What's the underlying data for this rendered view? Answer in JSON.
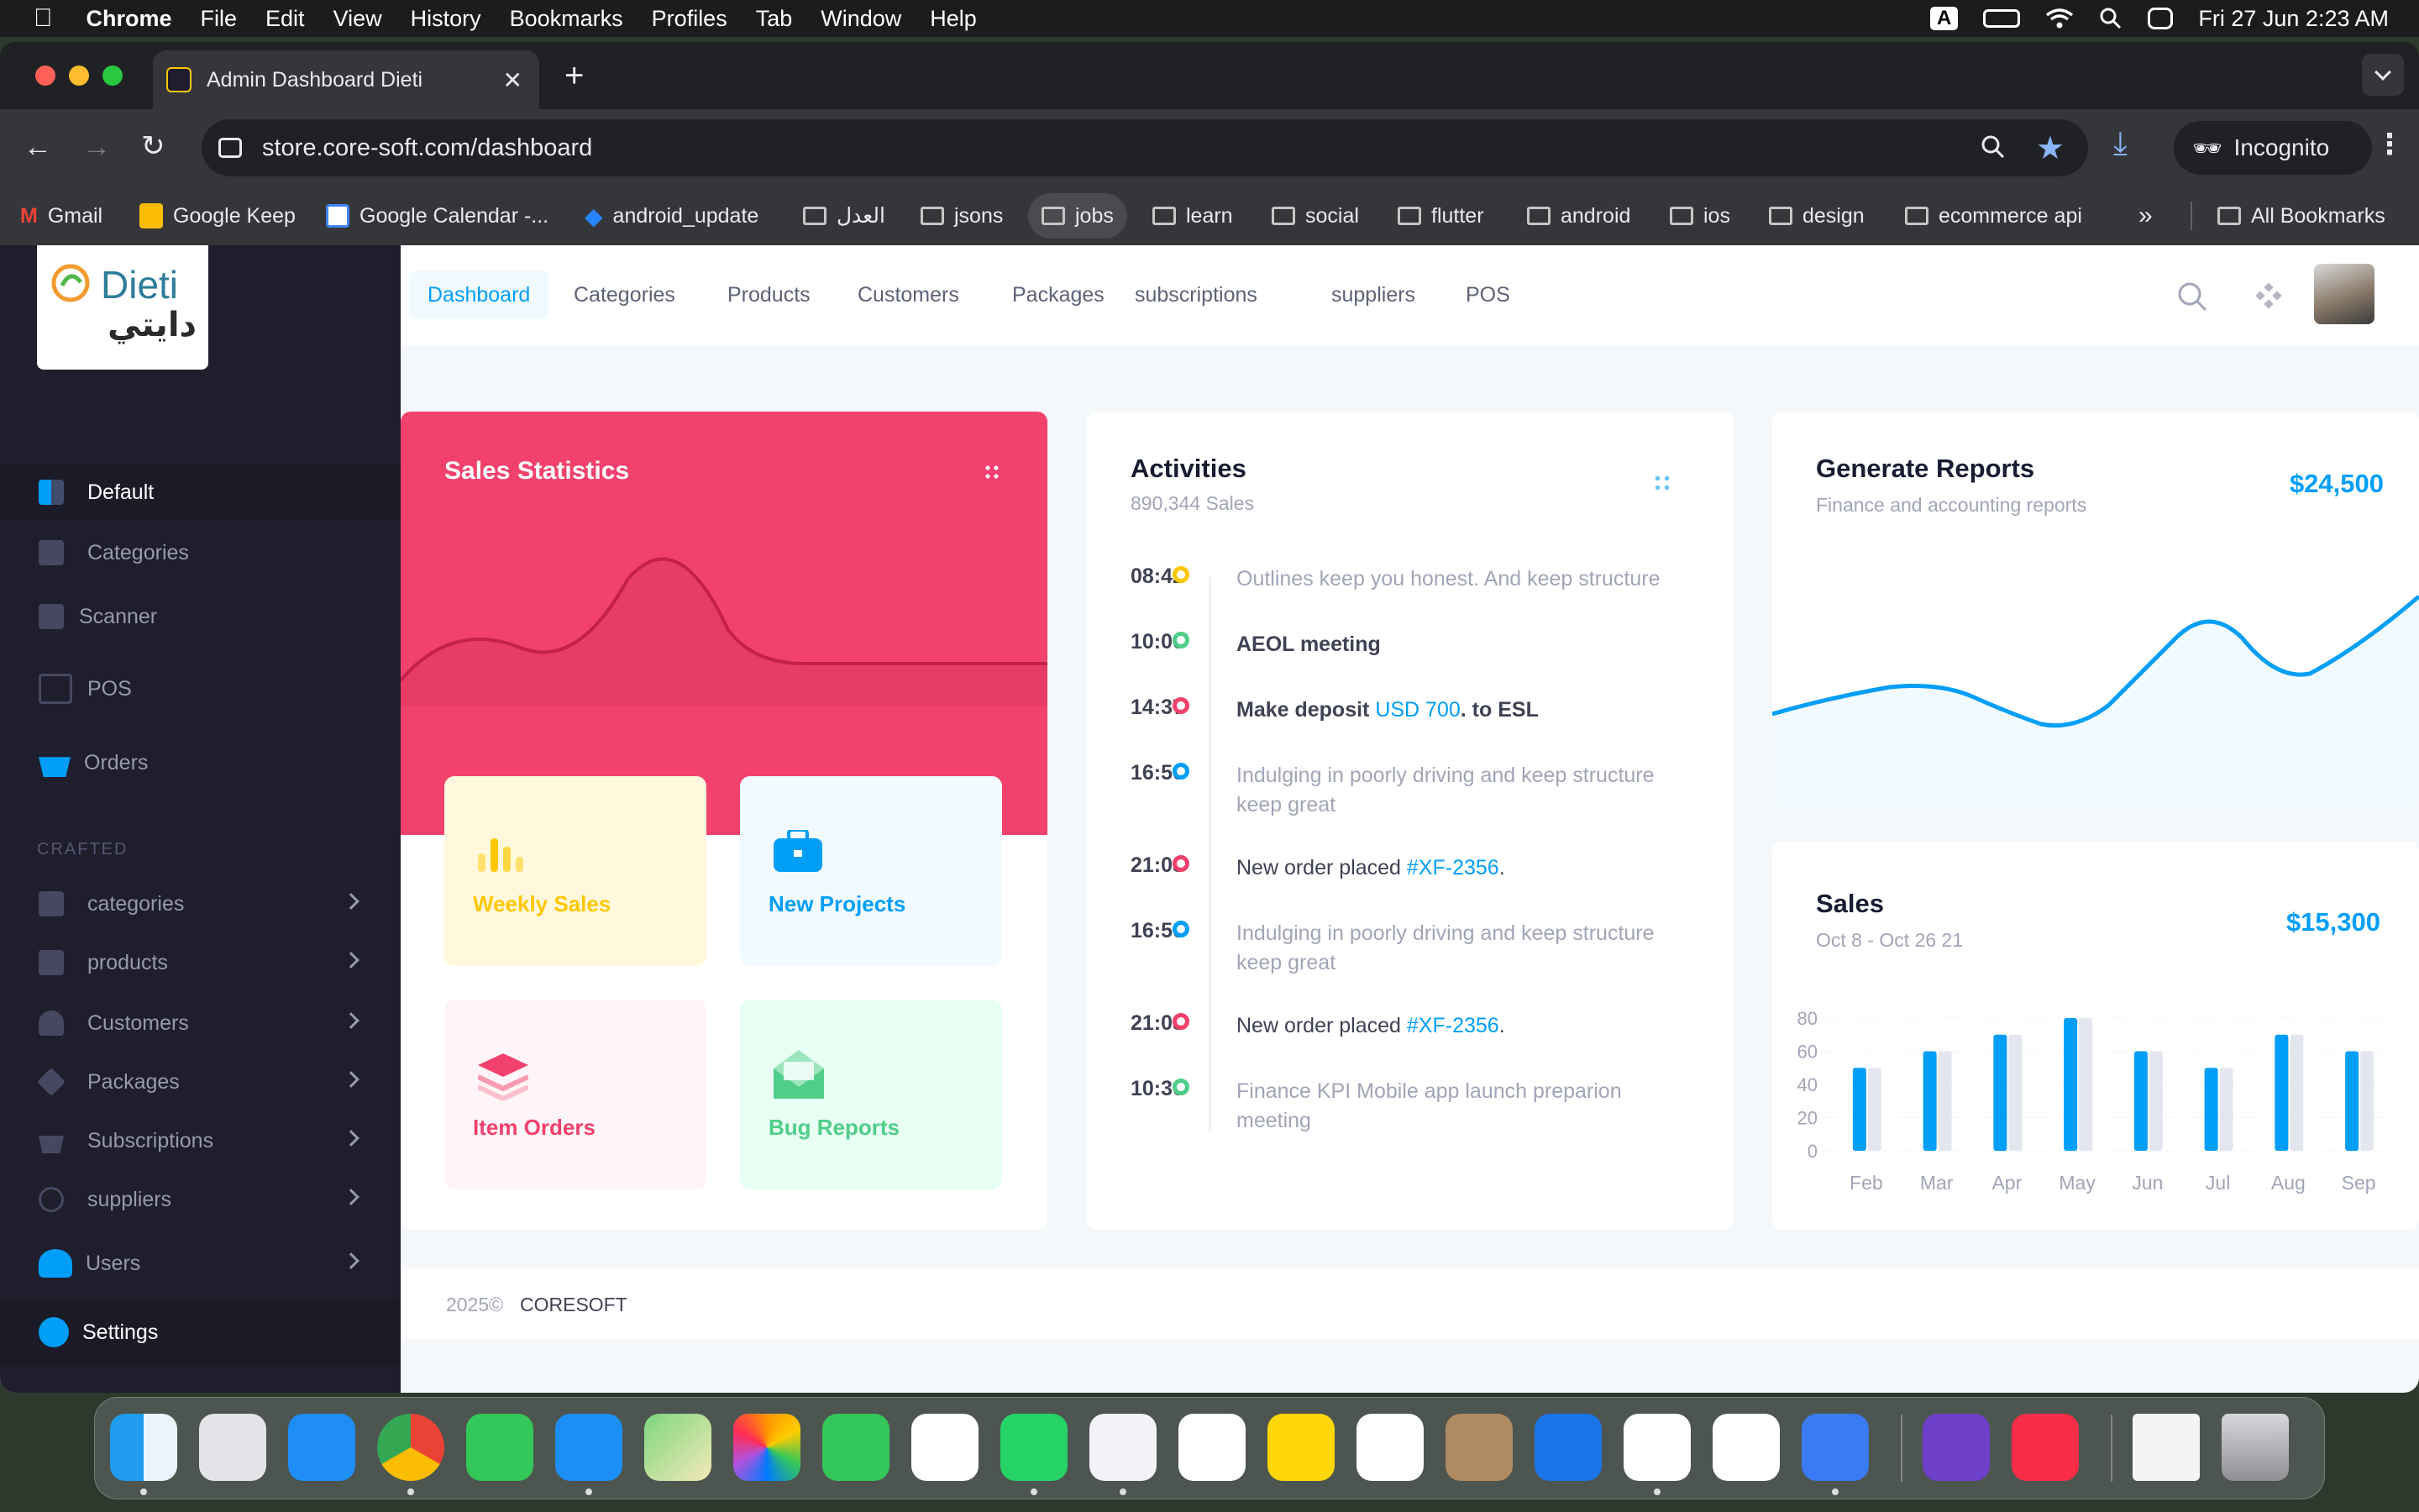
{
  "menubar": {
    "app": "Chrome",
    "items": [
      "File",
      "Edit",
      "View",
      "History",
      "Bookmarks",
      "Profiles",
      "Tab",
      "Window",
      "Help"
    ],
    "input_badge": "A",
    "datetime": "Fri 27 Jun  2:23 AM"
  },
  "browser": {
    "tab_title": "Admin Dashboard Dieti",
    "url": "store.core-soft.com/dashboard",
    "profile": "Incognito",
    "bookmarks": [
      "Gmail",
      "Google Keep",
      "Google Calendar -...",
      "android_update",
      "العدل",
      "jsons",
      "jobs",
      "learn",
      "social",
      "flutter",
      "android",
      "ios",
      "design",
      "ecommerce api"
    ],
    "overflow": "»",
    "all_bookmarks": "All Bookmarks"
  },
  "sidebar": {
    "logo_text": "Dieti",
    "logo_arabic": "دايتي",
    "main_items": [
      {
        "label": "Default",
        "icon": "dashboard-icon"
      },
      {
        "label": "Categories",
        "icon": "categories-icon"
      },
      {
        "label": "Scanner",
        "icon": "camera-icon"
      },
      {
        "label": "POS",
        "icon": "cart-icon"
      },
      {
        "label": "Orders",
        "icon": "basket-icon"
      }
    ],
    "section": "CRAFTED",
    "crafted_items": [
      {
        "label": "categories",
        "icon": "users-icon"
      },
      {
        "label": "products",
        "icon": "products-icon"
      },
      {
        "label": "Customers",
        "icon": "customer-icon"
      },
      {
        "label": "Packages",
        "icon": "layers-icon"
      },
      {
        "label": "Subscriptions",
        "icon": "basket-icon"
      },
      {
        "label": "suppliers",
        "icon": "fingerprint-icon"
      },
      {
        "label": "Users",
        "icon": "users-icon"
      }
    ],
    "settings": "Settings"
  },
  "topnav": {
    "items": [
      "Dashboard",
      "Categories",
      "Products",
      "Customers",
      "Packages",
      "subscriptions",
      "suppliers",
      "POS"
    ],
    "active": "Dashboard"
  },
  "sales_statistics": {
    "title": "Sales Statistics",
    "tiles": [
      {
        "label": "Weekly Sales",
        "icon": "bar-chart-icon",
        "color": "#ffc700"
      },
      {
        "label": "New Projects",
        "icon": "briefcase-icon",
        "color": "#009ef7"
      },
      {
        "label": "Item Orders",
        "icon": "layers-icon",
        "color": "#f1416c"
      },
      {
        "label": "Bug Reports",
        "icon": "envelope-icon",
        "color": "#50cd89"
      }
    ]
  },
  "activities": {
    "title": "Activities",
    "subtitle": "890,344 Sales",
    "items": [
      {
        "time": "08:42",
        "color": "#ffc700",
        "text": "Outlines keep you honest. And keep structure",
        "style": "muted"
      },
      {
        "time": "10:00",
        "color": "#50cd89",
        "text": "AEOL meeting",
        "style": "bold"
      },
      {
        "time": "14:37",
        "color": "#f1416c",
        "text_pre": "Make deposit ",
        "link": "USD 700",
        "text_post": ". to ESL",
        "style": "bold"
      },
      {
        "time": "16:50",
        "color": "#009ef7",
        "text": "Indulging in poorly driving and keep structure keep great",
        "style": "muted"
      },
      {
        "time": "21:03",
        "color": "#f1416c",
        "text_pre": "New order placed ",
        "link": "#XF-2356",
        "text_post": ".",
        "style": "semibold"
      },
      {
        "time": "16:50",
        "color": "#009ef7",
        "text": "Indulging in poorly driving and keep structure keep great",
        "style": "muted"
      },
      {
        "time": "21:03",
        "color": "#f1416c",
        "text_pre": "New order placed ",
        "link": "#XF-2356",
        "text_post": ".",
        "style": "semibold"
      },
      {
        "time": "10:30",
        "color": "#50cd89",
        "text": "Finance KPI Mobile app launch preparion meeting",
        "style": "muted"
      }
    ]
  },
  "generate_reports": {
    "title": "Generate Reports",
    "subtitle": "Finance and accounting reports",
    "amount": "$24,500"
  },
  "sales": {
    "title": "Sales",
    "subtitle": "Oct 8 - Oct 26 21",
    "amount": "$15,300"
  },
  "chart_data": {
    "type": "bar",
    "categories": [
      "Feb",
      "Mar",
      "Apr",
      "May",
      "Jun",
      "Jul",
      "Aug",
      "Sep"
    ],
    "series": [
      {
        "values": [
          50,
          60,
          70,
          80,
          60,
          50,
          70,
          60
        ]
      },
      {
        "values": [
          50,
          60,
          70,
          80,
          60,
          50,
          70,
          60
        ]
      }
    ],
    "yticks": [
      0,
      20,
      40,
      60,
      80
    ],
    "ylim": [
      0,
      80
    ],
    "colors": [
      "#009ef7",
      "#e4e6ef"
    ]
  },
  "footer": {
    "year": "2025©",
    "brand": "CORESOFT"
  }
}
